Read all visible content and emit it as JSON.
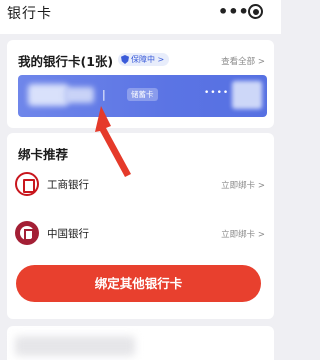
{
  "header": {
    "title": "银行卡",
    "more_label": "•••"
  },
  "my_cards": {
    "title": "我的银行卡(1张)",
    "badge": "保障中 >",
    "view_all": "查看全部 >",
    "card": {
      "separator": "|",
      "type": "储蓄卡",
      "masked": "••••"
    }
  },
  "recommend": {
    "title": "绑卡推荐",
    "banks": [
      {
        "name": "工商银行",
        "action": "立即绑卡 >"
      },
      {
        "name": "中国银行",
        "action": "立即绑卡 >"
      }
    ]
  },
  "cta": {
    "label": "绑定其他银行卡"
  },
  "colors": {
    "primary": "#e8402e",
    "card": "#5b74e4",
    "badge_text": "#3a5bd9",
    "arrow": "#e53a2a"
  }
}
